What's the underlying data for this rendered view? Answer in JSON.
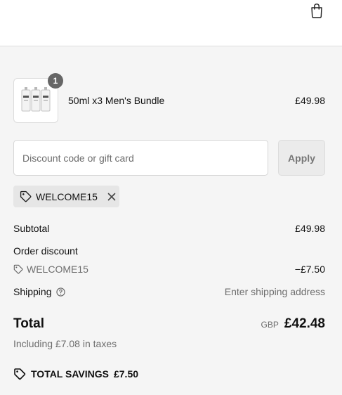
{
  "cart": {
    "product": {
      "name": "50ml x3 Men's Bundle",
      "price": "£49.98",
      "quantity": "1",
      "image": "three-perfume-bottles"
    }
  },
  "discount": {
    "placeholder": "Discount code or gift card",
    "value": "",
    "apply_label": "Apply",
    "applied_code": "WELCOME15"
  },
  "summary": {
    "subtotal_label": "Subtotal",
    "subtotal_value": "£49.98",
    "order_discount_label": "Order discount",
    "discount_code": "WELCOME15",
    "discount_value": "−£7.50",
    "shipping_label": "Shipping",
    "shipping_value": "Enter shipping address",
    "total_label": "Total",
    "currency": "GBP",
    "total_value": "£42.48",
    "taxes_text": "Including £7.08 in taxes",
    "savings_label": "TOTAL SAVINGS",
    "savings_value": "£7.50"
  },
  "icons": {
    "header": "shopping-bag-icon",
    "chip": "tag-icon",
    "chip_remove": "close-icon",
    "shipping_help": "help-circle-icon",
    "savings": "tag-icon"
  }
}
